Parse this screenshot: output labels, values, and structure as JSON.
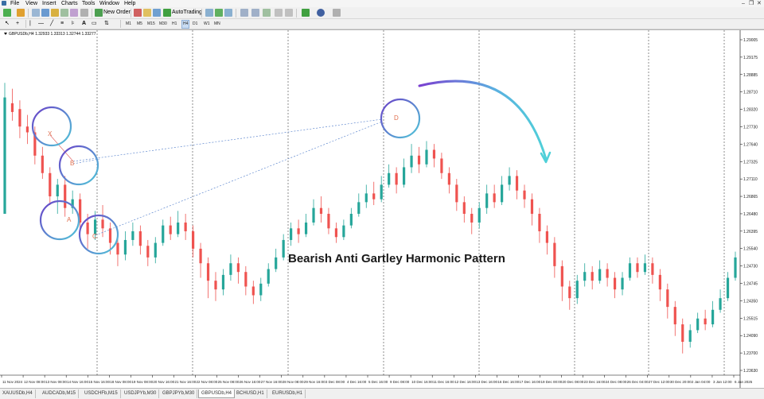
{
  "menu": {
    "items": [
      "File",
      "View",
      "Insert",
      "Charts",
      "Tools",
      "Window",
      "Help"
    ]
  },
  "toolbar": {
    "new_order_label": "New Order",
    "autotrading_label": "AutoTrading",
    "timeframes": [
      "M1",
      "M5",
      "M15",
      "M30",
      "H1",
      "H4",
      "D1",
      "W1",
      "MN"
    ],
    "active_timeframe": "H4"
  },
  "chart": {
    "symbol_info": "GBPUSDb,H4  1.32933 1.33313 1.32744 1.33277",
    "overlay_title": "Bearish Anti Gartley Harmonic Pattern",
    "pattern_points": [
      "X",
      "B",
      "A",
      "C",
      "D"
    ],
    "colors": {
      "bull": "#26a69a",
      "bear": "#ef5350",
      "circle": "#6a4fc8",
      "circle_end": "#4fc3d8"
    }
  },
  "chart_data": {
    "type": "candlestick",
    "y_ticks": [
      "1.29005",
      "1.29175",
      "1.28885",
      "1.28710",
      "1.28320",
      "1.27730",
      "1.27640",
      "1.27325",
      "1.27110",
      "1.26865",
      "1.26480",
      "1.26395",
      "1.25540",
      "1.24730",
      "1.24745",
      "1.24350",
      "1.25515",
      "1.24090",
      "1.23700",
      "1.23630"
    ],
    "x_ticks": [
      "11 Nov 2024",
      "12 Nov 08:00",
      "13 Nov 08:00",
      "14 Nov 16:00",
      "15 Nov 16:00",
      "18 Nov 08:00",
      "19 Nov 08:00",
      "20 Nov 16:00",
      "21 Nov 16:00",
      "22 Nov 08:00",
      "25 Nov 08:00",
      "26 Nov 16:00",
      "27 Nov 16:00",
      "28 Nov 08:00",
      "29 Nov 16:00",
      "3 Dec 08:00",
      "4 Dec 16:00",
      "5 Dec 16:00",
      "9 Dec 08:00",
      "10 Dec 16:00",
      "11 Dec 16:00",
      "12 Dec 16:00",
      "13 Dec 16:00",
      "16 Dec 16:00",
      "17 Dec 16:00",
      "19 Dec 00:00",
      "20 Dec 08:00",
      "23 Dec 16:00",
      "24 Dec 08:00",
      "26 Dec 04:00",
      "27 Dec 12:00",
      "30 Dec 20:00",
      "2 Jan 04:00",
      "3 Jan 12:00",
      "6 Jan 2025"
    ],
    "candles": [
      [
        0.5,
        0.9,
        0.5,
        0.95
      ],
      [
        0.88,
        0.85,
        0.82,
        0.93
      ],
      [
        0.86,
        0.8,
        0.76,
        0.89
      ],
      [
        0.8,
        0.78,
        0.74,
        0.84
      ],
      [
        0.78,
        0.7,
        0.67,
        0.8
      ],
      [
        0.7,
        0.64,
        0.62,
        0.73
      ],
      [
        0.64,
        0.56,
        0.53,
        0.66
      ],
      [
        0.56,
        0.6,
        0.5,
        0.62
      ],
      [
        0.6,
        0.52,
        0.49,
        0.63
      ],
      [
        0.52,
        0.55,
        0.5,
        0.58
      ],
      [
        0.55,
        0.47,
        0.44,
        0.57
      ],
      [
        0.47,
        0.43,
        0.38,
        0.5
      ],
      [
        0.43,
        0.48,
        0.41,
        0.51
      ],
      [
        0.48,
        0.45,
        0.42,
        0.53
      ],
      [
        0.45,
        0.4,
        0.36,
        0.47
      ],
      [
        0.4,
        0.36,
        0.32,
        0.42
      ],
      [
        0.36,
        0.41,
        0.34,
        0.44
      ],
      [
        0.41,
        0.44,
        0.39,
        0.47
      ],
      [
        0.44,
        0.39,
        0.36,
        0.46
      ],
      [
        0.39,
        0.35,
        0.32,
        0.41
      ],
      [
        0.35,
        0.4,
        0.33,
        0.42
      ],
      [
        0.4,
        0.46,
        0.39,
        0.48
      ],
      [
        0.46,
        0.43,
        0.41,
        0.49
      ],
      [
        0.43,
        0.47,
        0.42,
        0.51
      ],
      [
        0.47,
        0.44,
        0.41,
        0.5
      ],
      [
        0.44,
        0.38,
        0.35,
        0.46
      ],
      [
        0.38,
        0.33,
        0.28,
        0.4
      ],
      [
        0.33,
        0.27,
        0.21,
        0.35
      ],
      [
        0.27,
        0.24,
        0.2,
        0.3
      ],
      [
        0.24,
        0.29,
        0.22,
        0.31
      ],
      [
        0.29,
        0.33,
        0.27,
        0.36
      ],
      [
        0.33,
        0.3,
        0.26,
        0.35
      ],
      [
        0.3,
        0.25,
        0.22,
        0.32
      ],
      [
        0.25,
        0.22,
        0.19,
        0.27
      ],
      [
        0.22,
        0.26,
        0.2,
        0.28
      ],
      [
        0.26,
        0.31,
        0.25,
        0.33
      ],
      [
        0.31,
        0.35,
        0.3,
        0.38
      ],
      [
        0.35,
        0.41,
        0.34,
        0.43
      ],
      [
        0.41,
        0.45,
        0.39,
        0.47
      ],
      [
        0.45,
        0.43,
        0.4,
        0.48
      ],
      [
        0.43,
        0.47,
        0.42,
        0.5
      ],
      [
        0.47,
        0.52,
        0.46,
        0.55
      ],
      [
        0.52,
        0.5,
        0.47,
        0.56
      ],
      [
        0.5,
        0.45,
        0.43,
        0.52
      ],
      [
        0.45,
        0.42,
        0.4,
        0.47
      ],
      [
        0.42,
        0.46,
        0.41,
        0.48
      ],
      [
        0.46,
        0.5,
        0.45,
        0.52
      ],
      [
        0.5,
        0.54,
        0.49,
        0.57
      ],
      [
        0.54,
        0.57,
        0.52,
        0.6
      ],
      [
        0.57,
        0.55,
        0.53,
        0.61
      ],
      [
        0.55,
        0.6,
        0.54,
        0.63
      ],
      [
        0.6,
        0.64,
        0.59,
        0.67
      ],
      [
        0.64,
        0.6,
        0.57,
        0.66
      ],
      [
        0.6,
        0.66,
        0.59,
        0.69
      ],
      [
        0.66,
        0.7,
        0.64,
        0.74
      ],
      [
        0.7,
        0.67,
        0.64,
        0.73
      ],
      [
        0.67,
        0.72,
        0.66,
        0.75
      ],
      [
        0.72,
        0.69,
        0.66,
        0.74
      ],
      [
        0.69,
        0.64,
        0.62,
        0.71
      ],
      [
        0.64,
        0.6,
        0.57,
        0.66
      ],
      [
        0.6,
        0.54,
        0.51,
        0.62
      ],
      [
        0.54,
        0.5,
        0.47,
        0.56
      ],
      [
        0.5,
        0.47,
        0.43,
        0.52
      ],
      [
        0.47,
        0.52,
        0.45,
        0.54
      ],
      [
        0.52,
        0.57,
        0.5,
        0.6
      ],
      [
        0.57,
        0.54,
        0.52,
        0.6
      ],
      [
        0.54,
        0.6,
        0.53,
        0.63
      ],
      [
        0.6,
        0.63,
        0.58,
        0.66
      ],
      [
        0.63,
        0.58,
        0.55,
        0.65
      ],
      [
        0.58,
        0.55,
        0.52,
        0.6
      ],
      [
        0.55,
        0.5,
        0.46,
        0.57
      ],
      [
        0.5,
        0.44,
        0.4,
        0.52
      ],
      [
        0.44,
        0.4,
        0.36,
        0.46
      ],
      [
        0.4,
        0.32,
        0.28,
        0.42
      ],
      [
        0.32,
        0.25,
        0.2,
        0.34
      ],
      [
        0.25,
        0.21,
        0.17,
        0.27
      ],
      [
        0.21,
        0.27,
        0.19,
        0.29
      ],
      [
        0.27,
        0.3,
        0.25,
        0.33
      ],
      [
        0.3,
        0.27,
        0.24,
        0.32
      ],
      [
        0.27,
        0.31,
        0.26,
        0.34
      ],
      [
        0.31,
        0.28,
        0.25,
        0.33
      ],
      [
        0.28,
        0.24,
        0.21,
        0.3
      ],
      [
        0.24,
        0.28,
        0.22,
        0.3
      ],
      [
        0.28,
        0.33,
        0.27,
        0.35
      ],
      [
        0.33,
        0.3,
        0.28,
        0.35
      ],
      [
        0.3,
        0.33,
        0.29,
        0.36
      ],
      [
        0.33,
        0.29,
        0.26,
        0.35
      ],
      [
        0.29,
        0.24,
        0.2,
        0.31
      ],
      [
        0.24,
        0.18,
        0.14,
        0.26
      ],
      [
        0.18,
        0.12,
        0.08,
        0.2
      ],
      [
        0.12,
        0.06,
        0.02,
        0.14
      ],
      [
        0.06,
        0.1,
        0.04,
        0.12
      ],
      [
        0.1,
        0.14,
        0.09,
        0.16
      ],
      [
        0.14,
        0.12,
        0.1,
        0.17
      ],
      [
        0.12,
        0.17,
        0.11,
        0.2
      ],
      [
        0.17,
        0.21,
        0.16,
        0.24
      ],
      [
        0.21,
        0.28,
        0.2,
        0.3
      ],
      [
        0.28,
        0.35,
        0.27,
        0.37
      ]
    ]
  },
  "tabs": [
    {
      "label": "XAUUSDb,H4",
      "active": false
    },
    {
      "label": "AUDCADb,M15",
      "active": false
    },
    {
      "label": "USDCHFb,M15",
      "active": false
    },
    {
      "label": "USDJPYb,M30",
      "active": false
    },
    {
      "label": "GBPJPYb,M30",
      "active": false
    },
    {
      "label": "GBPUSDb,H4",
      "active": true
    },
    {
      "label": "BCHUSD,H1",
      "active": false
    },
    {
      "label": "EURUSDb,H1",
      "active": false
    }
  ]
}
